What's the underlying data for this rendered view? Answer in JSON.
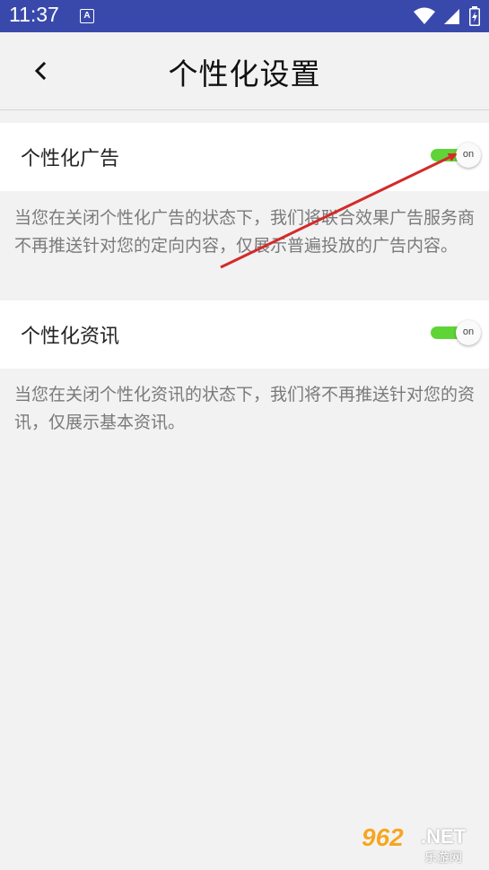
{
  "status_bar": {
    "time": "11:37",
    "notification_glyph": "A",
    "icons": [
      "wifi-icon",
      "signal-icon",
      "battery-icon"
    ]
  },
  "app_bar": {
    "back_icon": "chevron-left-icon",
    "title": "个性化设置"
  },
  "settings": [
    {
      "label": "个性化广告",
      "toggle_state": "on",
      "description": "当您在关闭个性化广告的状态下，我们将联合效果广告服务商不再推送针对您的定向内容，仅展示普遍投放的广告内容。"
    },
    {
      "label": "个性化资讯",
      "toggle_state": "on",
      "description": "当您在关闭个性化资讯的状态下，我们将不再推送针对您的资讯，仅展示基本资讯。"
    }
  ],
  "watermark": {
    "brand_number": "962",
    "brand_domain": ".NET",
    "brand_name": "乐游网"
  },
  "colors": {
    "status_bar": "#3949ab",
    "toggle_on": "#5fd437",
    "annotation_arrow": "#d42a2a"
  }
}
